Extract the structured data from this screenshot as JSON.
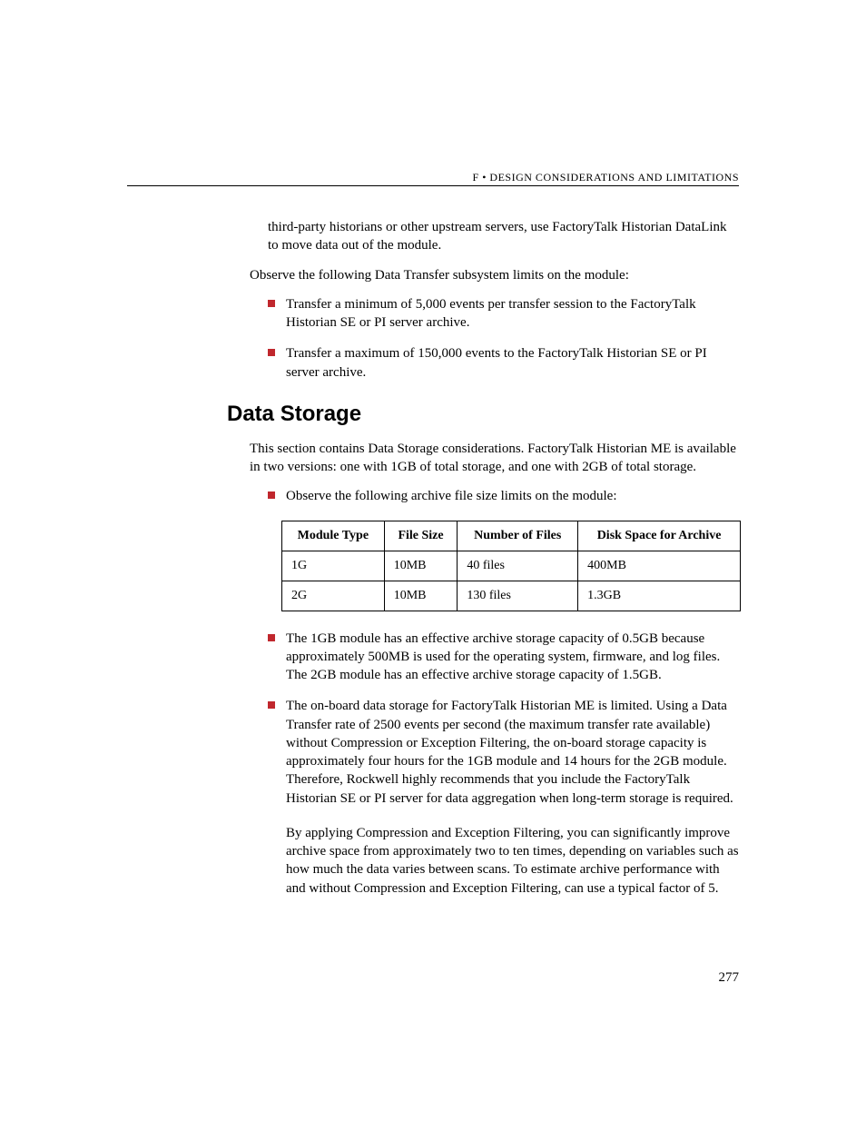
{
  "header": {
    "prefix": "F",
    "bullet": "•",
    "title_part1": "D",
    "title_rest1": "ESIGN ",
    "title_part2": "C",
    "title_rest2": "ONSIDERATIONS AND ",
    "title_part3": "L",
    "title_rest3": "IMITATIONS"
  },
  "top_paragraph": "third-party historians or other upstream servers, use FactoryTalk Historian DataLink to move data out of the module.",
  "observe_limits": "Observe the following Data Transfer subsystem limits on the module:",
  "limits": [
    "Transfer a minimum of 5,000 events per transfer session to the FactoryTalk Historian SE or PI server archive.",
    "Transfer a maximum of 150,000 events to the FactoryTalk Historian SE or PI server archive."
  ],
  "section_heading": "Data Storage",
  "section_intro": "This section contains Data Storage considerations. FactoryTalk Historian ME is available in two versions: one with 1GB of total storage, and one with 2GB of total storage.",
  "observe_archive": "Observe the following archive file size limits on the module:",
  "table": {
    "headers": [
      "Module Type",
      "File Size",
      "Number of Files",
      "Disk Space for Archive"
    ],
    "rows": [
      [
        "1G",
        "10MB",
        "40 files",
        "400MB"
      ],
      [
        "2G",
        "10MB",
        "130 files",
        "1.3GB"
      ]
    ]
  },
  "post_bullets": [
    "The 1GB module has an effective archive storage capacity of 0.5GB because approximately 500MB is used for the operating system, firmware, and log files. The 2GB module has an effective archive storage capacity of 1.5GB.",
    "The on-board data storage for FactoryTalk Historian ME is limited. Using a Data Transfer rate of 2500 events per second (the maximum transfer rate available) without Compression or Exception Filtering, the on-board storage capacity is approximately four hours for the 1GB module and 14 hours for the 2GB module. Therefore, Rockwell highly recommends that you include the FactoryTalk Historian SE or PI server for data aggregation when long-term storage is required."
  ],
  "compression_para": "By applying Compression and Exception Filtering, you can significantly improve archive space from approximately two to ten times, depending on variables such as how much the data varies between scans. To estimate archive performance with and without Compression and Exception Filtering, can use a typical factor of 5.",
  "page_number": "277"
}
